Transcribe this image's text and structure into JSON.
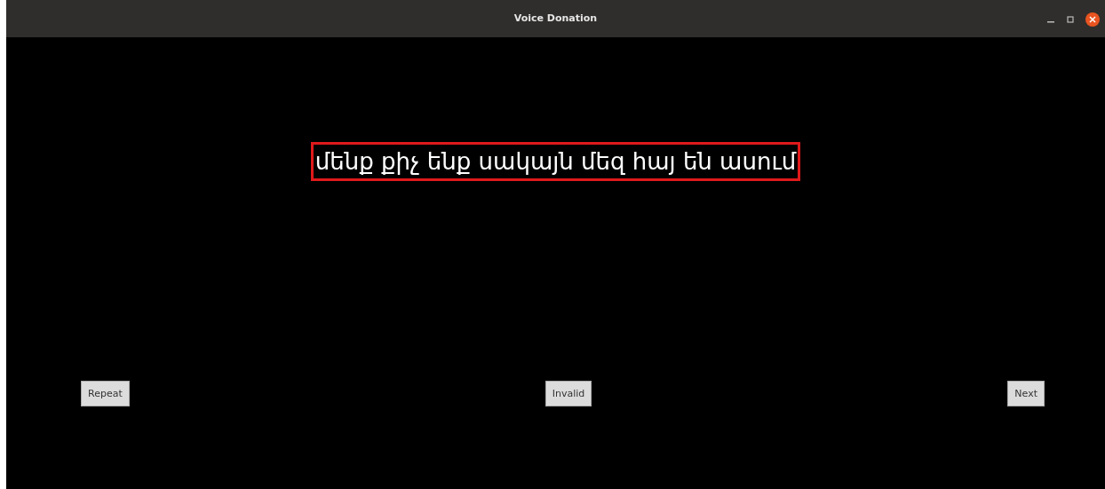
{
  "window": {
    "title": "Voice Donation"
  },
  "sentence": "մենք քիչ ենք սակայն մեզ հայ են ասում",
  "buttons": [
    {
      "label": "Repeat"
    },
    {
      "label": "Invalid"
    },
    {
      "label": "Next"
    }
  ]
}
